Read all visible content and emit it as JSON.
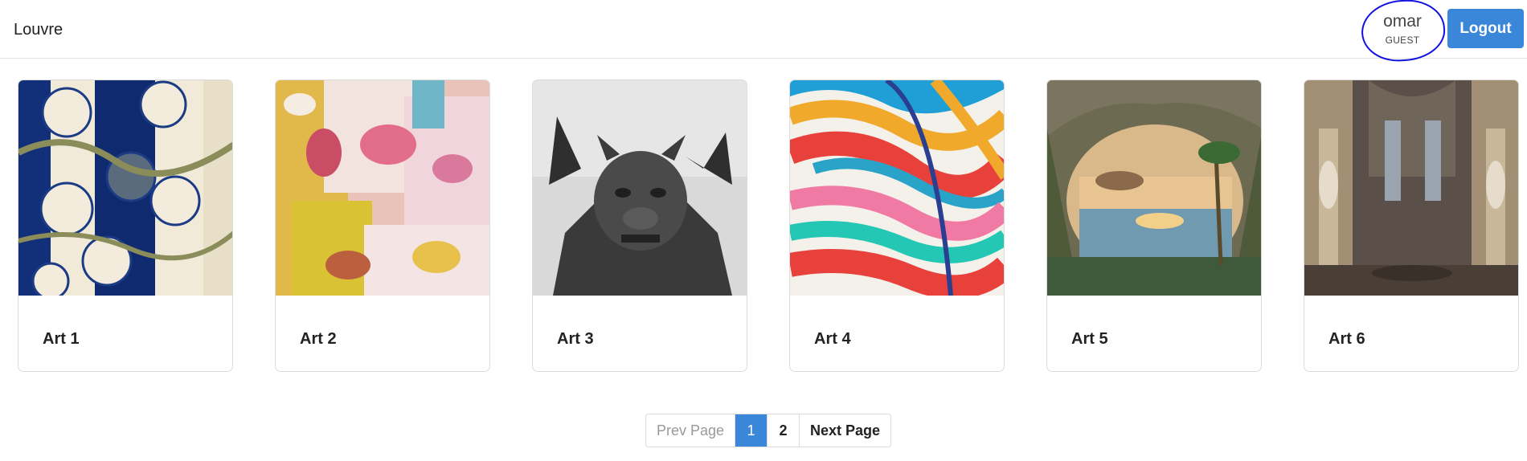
{
  "navbar": {
    "brand": "Louvre",
    "user": {
      "name": "omar",
      "role": "GUEST"
    },
    "logout_label": "Logout"
  },
  "cards": [
    {
      "title": "Art 1",
      "image": "blue-floral-pattern"
    },
    {
      "title": "Art 2",
      "image": "abstract-paint-splatter"
    },
    {
      "title": "Art 3",
      "image": "gargoyle-statue"
    },
    {
      "title": "Art 4",
      "image": "colorful-wavy-stripes"
    },
    {
      "title": "Art 5",
      "image": "grotto-lake-landscape"
    },
    {
      "title": "Art 6",
      "image": "gothic-cathedral-interior"
    }
  ],
  "pagination": {
    "prev_label": "Prev Page",
    "pages": [
      "1",
      "2"
    ],
    "current": "1",
    "next_label": "Next Page"
  },
  "colors": {
    "accent": "#3a87d9",
    "annotation_circle": "#1212e0"
  }
}
